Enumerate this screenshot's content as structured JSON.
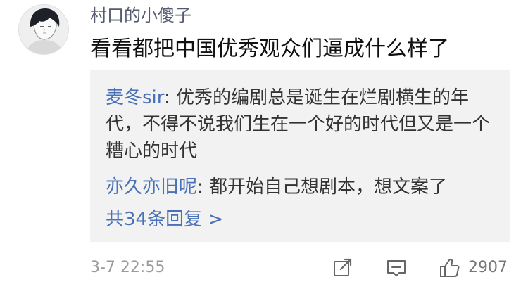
{
  "comment": {
    "username": "村口的小傻子",
    "text": "看看都把中国优秀观众们逼成什么样了",
    "timestamp": "3-7 22:55",
    "like_count": "2907"
  },
  "replies": [
    {
      "author": "麦冬sir",
      "separator": ": ",
      "text": "优秀的编剧总是诞生在烂剧横生的年代，不得不说我们生在一个好的时代但又是一个糟心的时代"
    },
    {
      "author": "亦久亦旧呢",
      "separator": ": ",
      "text": "都开始自己想剧本，想文案了"
    }
  ],
  "more_replies_label": "共34条回复 >",
  "icons": {
    "avatar": "avatar",
    "share": "share-icon",
    "comment": "comment-icon",
    "like": "thumbs-up-icon"
  },
  "colors": {
    "username": "#555b6e",
    "link_blue": "#4a71b8",
    "reply_background": "#f2f2f2",
    "timestamp": "#9b9b9b"
  }
}
